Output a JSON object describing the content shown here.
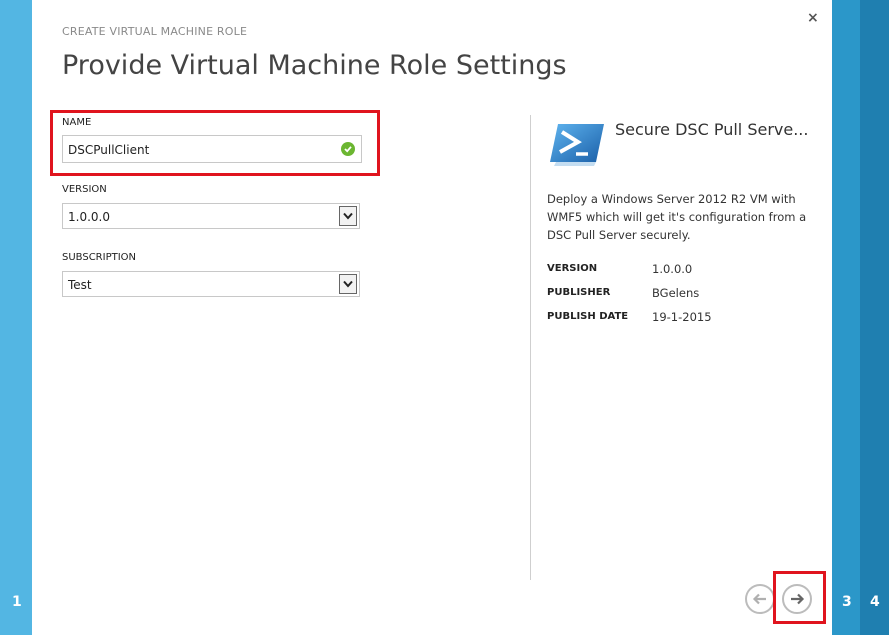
{
  "wizard": {
    "kicker": "CREATE VIRTUAL MACHINE ROLE",
    "title": "Provide Virtual Machine Role Settings",
    "close_label": "×"
  },
  "steps": {
    "left": "1",
    "right": [
      "3",
      "4"
    ]
  },
  "form": {
    "name": {
      "label": "NAME",
      "value": "DSCPullClient"
    },
    "version": {
      "label": "VERSION",
      "value": "1.0.0.0"
    },
    "subscription": {
      "label": "SUBSCRIPTION",
      "value": "Test"
    }
  },
  "package": {
    "title": "Secure DSC Pull Serve...",
    "description": "Deploy a Windows Server 2012 R2 VM with WMF5 which will get it's configuration from a DSC Pull Server securely.",
    "meta": [
      {
        "key": "VERSION",
        "value": "1.0.0.0"
      },
      {
        "key": "PUBLISHER",
        "value": "BGelens"
      },
      {
        "key": "PUBLISH DATE",
        "value": "19-1-2015"
      }
    ]
  },
  "colors": {
    "left_rail": "#53b6e3",
    "right_rail": "#2b97c9",
    "highlight": "#e0141e",
    "valid_check": "#6bb631"
  }
}
